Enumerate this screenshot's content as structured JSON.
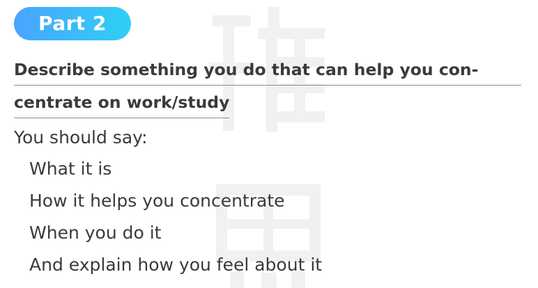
{
  "badge": {
    "label": "Part 2",
    "gradient_start": "#4aa3ff",
    "gradient_end": "#2fd0f5"
  },
  "topic": {
    "line1": "Describe something you do that can help you con-",
    "line2": "centrate on work/study"
  },
  "prompt": {
    "intro": "You should say:",
    "items": [
      "What it is",
      "How it helps you concentrate",
      "When you do it",
      "And explain how you feel about it"
    ]
  },
  "watermark": {
    "text": "雅思",
    "color": "#f1f1f1"
  }
}
